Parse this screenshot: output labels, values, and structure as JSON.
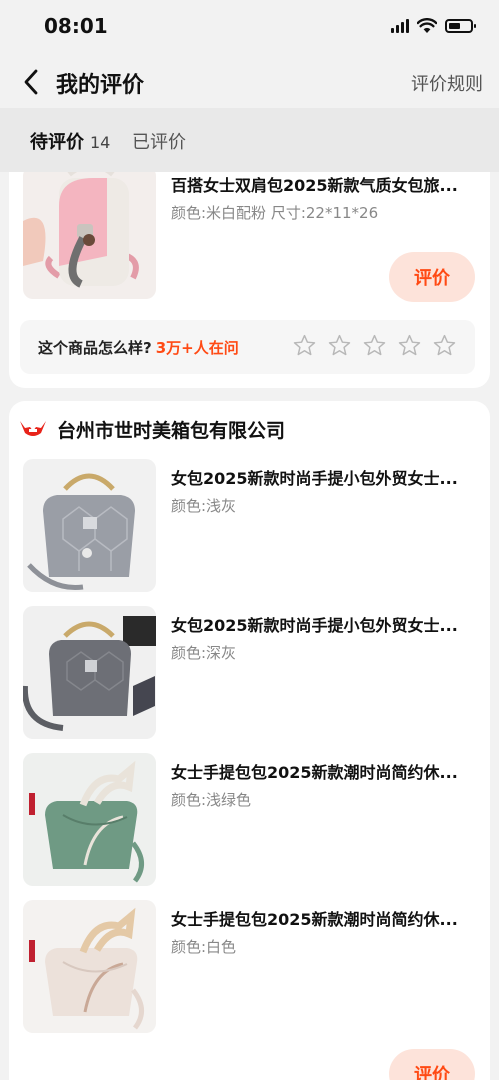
{
  "status_bar": {
    "time": "08:01"
  },
  "nav": {
    "title": "我的评价",
    "rules_label": "评价规则"
  },
  "tabs": {
    "pending_label": "待评价",
    "pending_count": "14",
    "done_label": "已评价"
  },
  "colors": {
    "accent": "#ff4a14",
    "accent_bg": "#fde3da",
    "page_bg": "#f2f2f2"
  },
  "first_card": {
    "item": {
      "title": "百搭女士双肩包2025新款气质女包旅...",
      "spec": "颜色:米白配粉  尺寸:22*11*26"
    },
    "review_label": "评价",
    "prompt": {
      "question": "这个商品怎么样?",
      "highlight": "3万+人在问"
    },
    "rating_stars": 5
  },
  "shop": {
    "icon": "shop-logo-icon",
    "name": "台州市世时美箱包有限公司",
    "items": [
      {
        "title": "女包2025新款时尚手提小包外贸女士...",
        "spec": "颜色:浅灰"
      },
      {
        "title": "女包2025新款时尚手提小包外贸女士...",
        "spec": "颜色:深灰"
      },
      {
        "title": "女士手提包包2025新款潮时尚简约休...",
        "spec": "颜色:浅绿色"
      },
      {
        "title": "女士手提包包2025新款潮时尚简约休...",
        "spec": "颜色:白色"
      }
    ],
    "review_label": "评价"
  }
}
